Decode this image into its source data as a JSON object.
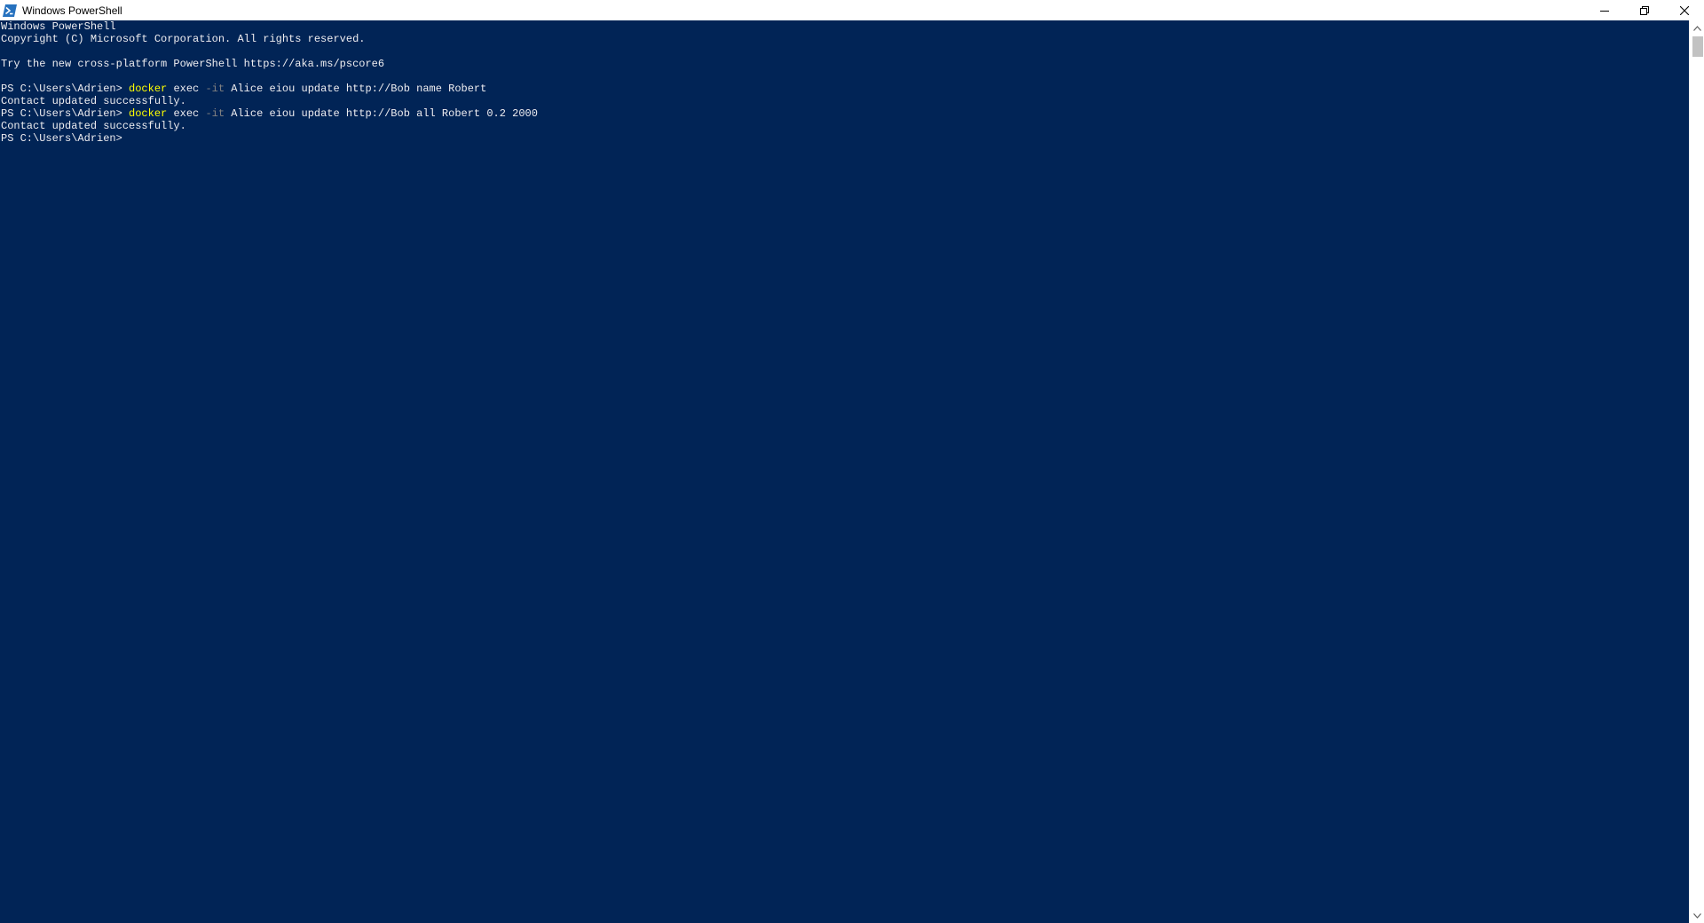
{
  "window": {
    "title": "Windows PowerShell",
    "icon": "powershell-icon",
    "controls": [
      "minimize-icon",
      "restore-icon",
      "close-icon"
    ]
  },
  "colors": {
    "background": "#012456",
    "text": "#eeedf0",
    "command": "#ffff00",
    "parameter": "#808080"
  },
  "terminal": {
    "banner": [
      "Windows PowerShell",
      "Copyright (C) Microsoft Corporation. All rights reserved.",
      "",
      "Try the new cross-platform PowerShell https://aka.ms/pscore6",
      ""
    ],
    "prompt": "PS C:\\Users\\Adrien> ",
    "commands": [
      {
        "command": "docker",
        "pre": " exec ",
        "param": "-it",
        "args": " Alice eiou update http://Bob name Robert",
        "output": "Contact updated successfully."
      },
      {
        "command": "docker",
        "pre": " exec ",
        "param": "-it",
        "args": " Alice eiou update http://Bob all Robert 0.2 2000",
        "output": "Contact updated successfully."
      }
    ]
  }
}
